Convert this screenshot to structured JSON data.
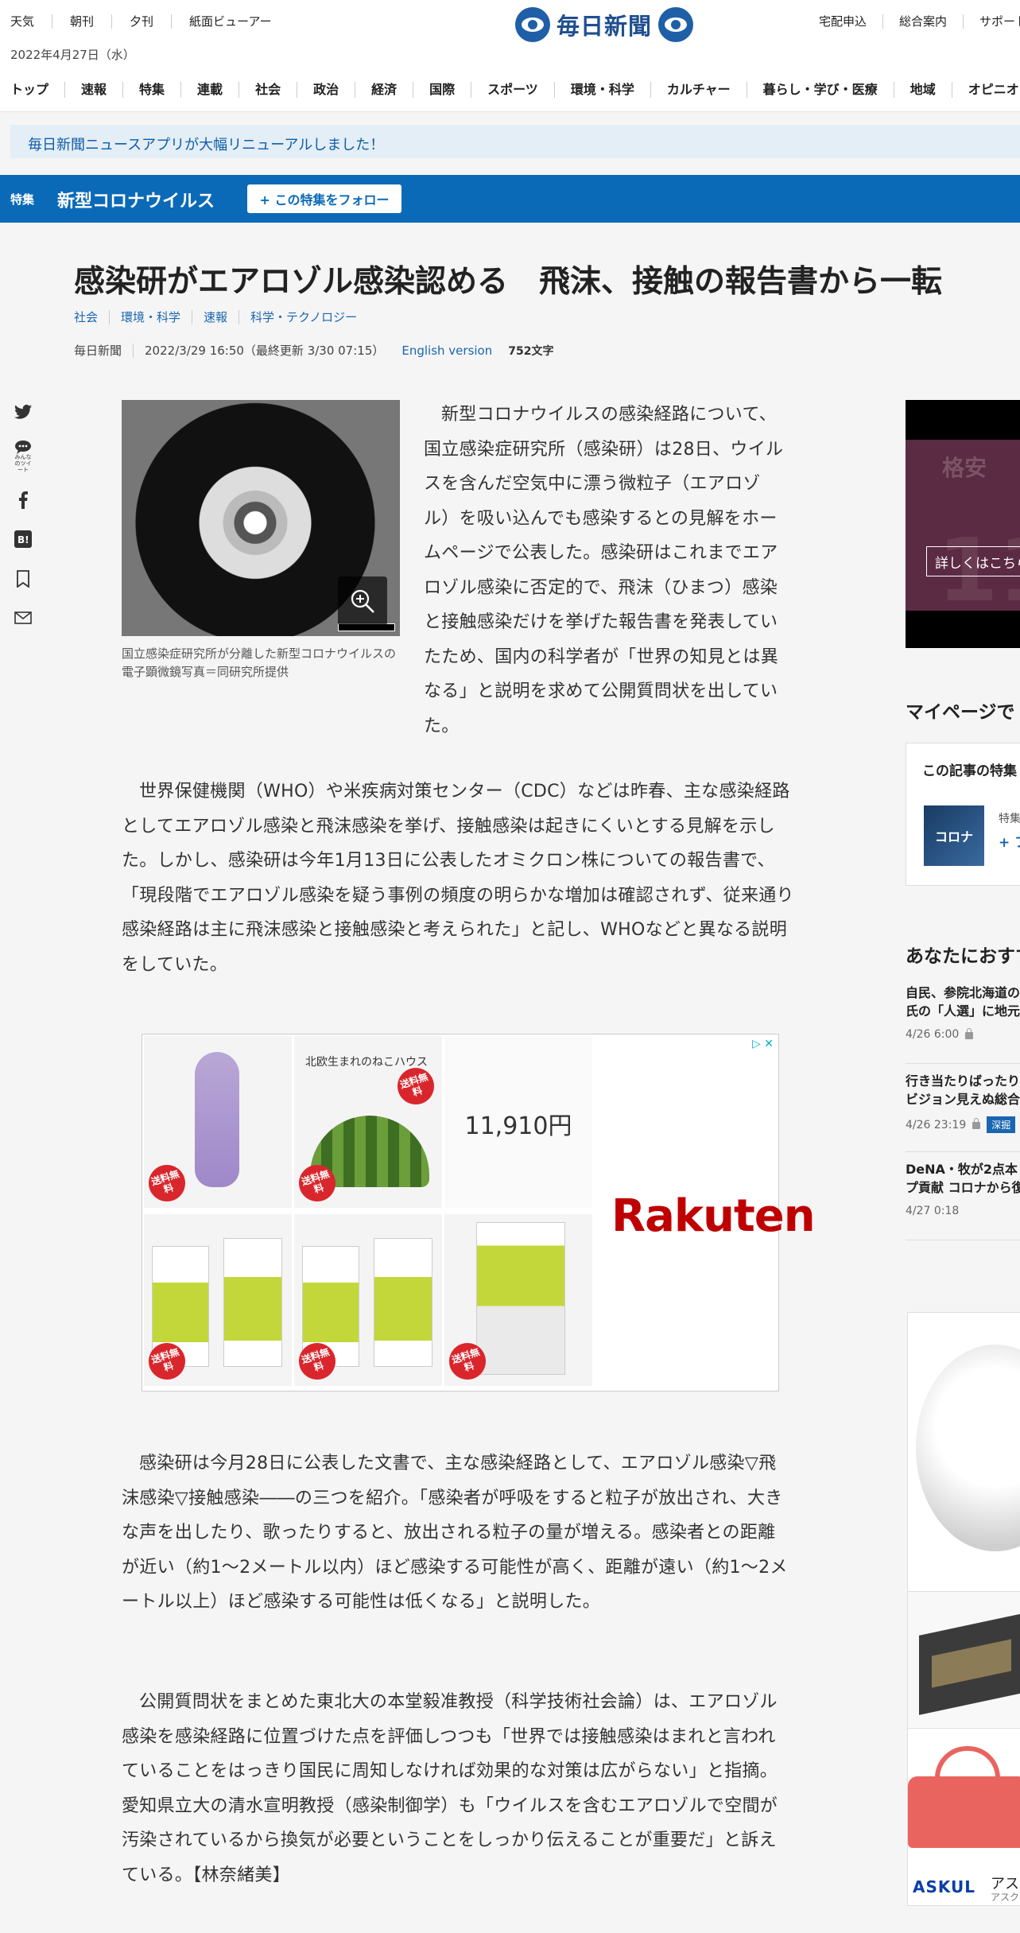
{
  "header": {
    "utility_left": [
      "天気",
      "朝刊",
      "夕刊",
      "紙面ビューアー"
    ],
    "date": "2022年4月27日（水）",
    "logo_text": "毎日新聞",
    "utility_right": [
      "宅配申込",
      "総合案内",
      "サポート"
    ],
    "nav": [
      "トップ",
      "速報",
      "特集",
      "連載",
      "社会",
      "政治",
      "経済",
      "国際",
      "スポーツ",
      "環境・科学",
      "カルチャー",
      "暮らし・学び・医療",
      "地域",
      "オピニオン"
    ]
  },
  "notice": "毎日新聞ニュースアプリが大幅リニューアルしました！",
  "special": {
    "tag": "特集",
    "title": "新型コロナウイルス",
    "follow_label": "+ この特集をフォロー"
  },
  "article": {
    "headline": "感染研がエアロゾル感染認める　飛沫、接触の報告書から一転",
    "categories": [
      "社会",
      "環境・科学",
      "速報",
      "科学・テクノロジー"
    ],
    "publisher": "毎日新聞",
    "datetime": "2022/3/29 16:50（最終更新 3/30 07:15）",
    "english_version": "English version",
    "char_count": "752文字",
    "photo_caption": "国立感染症研究所が分離した新型コロナウイルスの電子顕微鏡写真＝同研究所提供",
    "paragraphs": [
      "新型コロナウイルスの感染経路について、国立感染症研究所（感染研）は28日、ウイルスを含んだ空気中に漂う微粒子（エアロゾル）を吸い込んでも感染するとの見解をホームページで公表した。感染研はこれまでエアロゾル感染に否定的で、飛沫（ひまつ）感染と接触感染だけを挙げた報告書を発表していたため、国内の科学者が「世界の知見とは異なる」と説明を求めて公開質問状を出していた。",
      "世界保健機関（WHO）や米疾病対策センター（CDC）などは昨春、主な感染経路としてエアロゾル感染と飛沫感染を挙げ、接触感染は起きにくいとする見解を示した。しかし、感染研は今年1月13日に公表したオミクロン株についての報告書で、「現段階でエアロゾル感染を疑う事例の頻度の明らかな増加は確認されず、従来通り感染経路は主に飛沫感染と接触感染と考えられた」と記し、WHOなどと異なる説明をしていた。",
      "感染研は今月28日に公表した文書で、主な感染経路として、エアロゾル感染▽飛沫感染▽接触感染――の三つを紹介。「感染者が呼吸をすると粒子が放出され、大きな声を出したり、歌ったりすると、放出される粒子の量が増える。感染者との距離が近い（約1～2メートル以内）ほど感染する可能性が高く、距離が遠い（約1～2メートル以上）ほど感染する可能性は低くなる」と説明した。",
      "公開質問状をまとめた東北大の本堂毅准教授（科学技術社会論）は、エアロゾル感染を感染経路に位置づけた点を評価しつつも「世界では接触感染はまれと言われていることをはっきり国民に周知しなければ効果的な対策は広がらない」と指摘。愛知県立大の清水宣明教授（感染制御学）も「ウイルスを含むエアロゾルで空間が汚染されているから換気が必要ということをしっかり伝えることが重要だ」と訴えている。【林奈緒美】"
    ]
  },
  "share": {
    "minnano_label": "みんなのツイート"
  },
  "ad": {
    "badge": "送料無料",
    "price": "11,910円",
    "cat_text": "北欧生まれのねこハウス",
    "brand": "Rakuten"
  },
  "sidebar": {
    "ad_gold": "格安",
    "ad_big": "11",
    "ad_button": "詳しくはこちら",
    "mypage_heading": "マイページで",
    "mypage_box_title": "この記事の特集",
    "mypage_thumb": "コロナ",
    "mypage_box_tag": "特集",
    "mypage_box_follow": "+ フ",
    "recommend_heading": "あなたにおすすめ",
    "recommend": [
      {
        "title_1": "自民、参院北海道の",
        "title_2": "氏の「人選」に地元",
        "date": "4/26 6:00",
        "locked": true,
        "badge": ""
      },
      {
        "title_1": "行き当たりばったり",
        "title_2": "ビジョン見えぬ総合",
        "date": "4/26 23:19",
        "locked": true,
        "badge": "深掘"
      },
      {
        "title_1": "DeNA・牧が2点本",
        "title_2": "プ貢献 コロナから復",
        "date": "4/27 0:18",
        "locked": false,
        "badge": ""
      }
    ],
    "shop_brand": "ASKUL",
    "shop_title": "アス",
    "shop_sub": "アスク"
  }
}
